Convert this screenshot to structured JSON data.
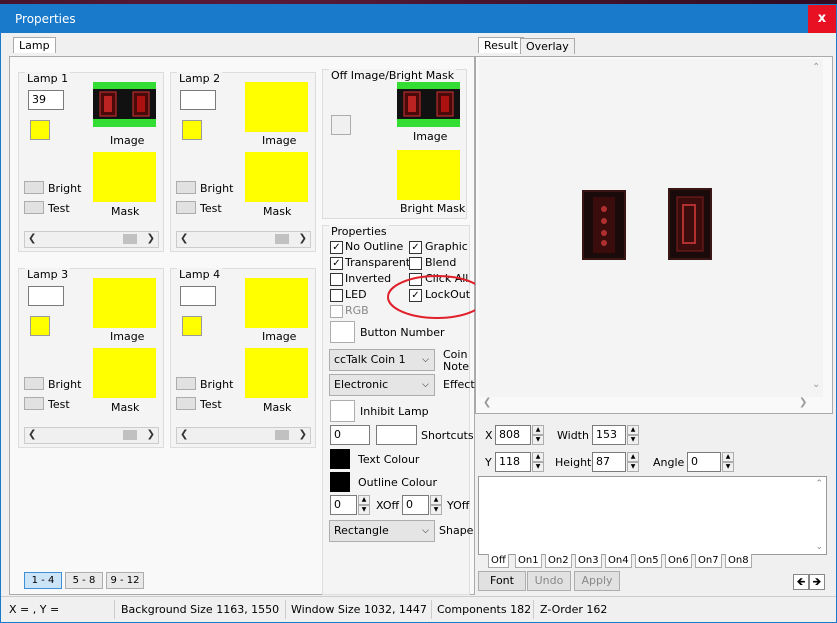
{
  "window": {
    "title": "Properties",
    "close": "x"
  },
  "left_tab": "Lamp",
  "lamp_labels": {
    "image": "Image",
    "mask": "Mask",
    "bright": "Bright",
    "test": "Test"
  },
  "lamps": [
    {
      "title": "Lamp 1",
      "value": "39"
    },
    {
      "title": "Lamp 2",
      "value": ""
    },
    {
      "title": "Lamp 3",
      "value": ""
    },
    {
      "title": "Lamp 4",
      "value": ""
    }
  ],
  "off_image": {
    "title": "Off Image/Bright Mask",
    "image_label": "Image",
    "mask_label": "Bright Mask"
  },
  "properties": {
    "title": "Properties",
    "checkboxes": [
      {
        "label": "No Outline",
        "checked": true
      },
      {
        "label": "Graphic",
        "checked": true
      },
      {
        "label": "Transparent",
        "checked": true
      },
      {
        "label": "Blend",
        "checked": false
      },
      {
        "label": "Inverted",
        "checked": false
      },
      {
        "label": "Click All",
        "checked": false
      },
      {
        "label": "LED",
        "checked": false
      },
      {
        "label": "LockOut",
        "checked": true
      },
      {
        "label": "RGB",
        "checked": false
      }
    ],
    "button_number_label": "Button Number",
    "coin_select": "ccTalk Coin 1",
    "coin_note_label": "Coin Note",
    "effect_select": "Electronic",
    "effect_label": "Effect",
    "inhibit_lamp_label": "Inhibit Lamp",
    "shortcuts_value": "0",
    "shortcuts_label": "Shortcuts",
    "text_colour_label": "Text Colour",
    "outline_colour_label": "Outline Colour",
    "xoff_value": "0",
    "xoff_label": "XOff",
    "yoff_value": "0",
    "yoff_label": "YOff",
    "shape_select": "Rectangle",
    "shape_label": "Shape"
  },
  "pages": [
    "1 - 4",
    "5 - 8",
    "9 - 12"
  ],
  "right_tabs": [
    "Result",
    "Overlay"
  ],
  "geometry": {
    "x_label": "X",
    "x_value": "808",
    "width_label": "Width",
    "width_value": "153",
    "y_label": "Y",
    "y_value": "118",
    "height_label": "Height",
    "height_value": "87",
    "angle_label": "Angle",
    "angle_value": "0"
  },
  "state_tabs": [
    "Off",
    "On1",
    "On2",
    "On3",
    "On4",
    "On5",
    "On6",
    "On7",
    "On8"
  ],
  "bottom_buttons": {
    "font": "Font",
    "undo": "Undo",
    "apply": "Apply"
  },
  "status": {
    "coords": "X = , Y =",
    "background_size": "Background Size 1163, 1550",
    "window_size": "Window Size 1032, 1447",
    "components": "Components 182",
    "zorder": "Z-Order 162"
  },
  "colors": {
    "accent": "#1979ca",
    "swatch": "#ffff00",
    "close": "#e81123",
    "annotation": "#e0202a"
  }
}
